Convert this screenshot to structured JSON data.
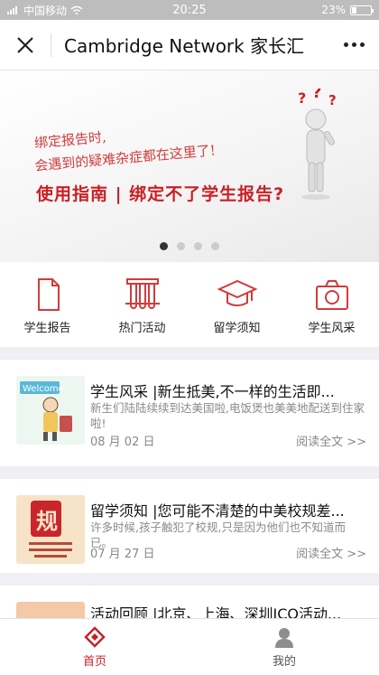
{
  "status_bar": {
    "carrier": "中国移动",
    "time": "20:25",
    "battery": "23%",
    "battery_level": 0.23
  },
  "nav": {
    "title": "Cambridge Network 家长汇",
    "close_icon": "close-icon",
    "more_icon": "more-icon"
  },
  "banner": {
    "line1": "绑定报告时,",
    "line2": "会遇到的疑难杂症都在这里了!",
    "headline": "使用指南 | 绑定不了学生报告?",
    "slide_count": 4,
    "active_slide": 0
  },
  "shortcuts": [
    {
      "label": "学生报告",
      "icon": "document-icon"
    },
    {
      "label": "热门活动",
      "icon": "test-tubes-icon"
    },
    {
      "label": "留学须知",
      "icon": "graduation-cap-icon"
    },
    {
      "label": "学生风采",
      "icon": "camera-icon"
    }
  ],
  "articles": [
    {
      "title": "学生风采 |新生抵美,不一样的生活即...",
      "summary": "新生们陆陆续续到达美国啦,电饭煲也美美地配送到住家啦!",
      "date": "08 月 02 日",
      "read_more": "阅读全文 >>",
      "thumb_text": "Welcome"
    },
    {
      "title": "留学须知 |您可能不清楚的中美校规差...",
      "summary": "许多时候,孩子触犯了校规,只是因为他们也不知道而已。",
      "date": "07 月 27 日",
      "read_more": "阅读全文 >>",
      "thumb_text": "规"
    },
    {
      "title": "活动回顾 |北京、上海、深圳ICO活动..."
    }
  ],
  "tab_bar": {
    "items": [
      {
        "label": "首页",
        "icon": "home-icon",
        "active": true
      },
      {
        "label": "我的",
        "icon": "user-icon",
        "active": false
      }
    ]
  },
  "colors": {
    "accent": "#c82026",
    "status_bar": "#bdbdbd"
  }
}
